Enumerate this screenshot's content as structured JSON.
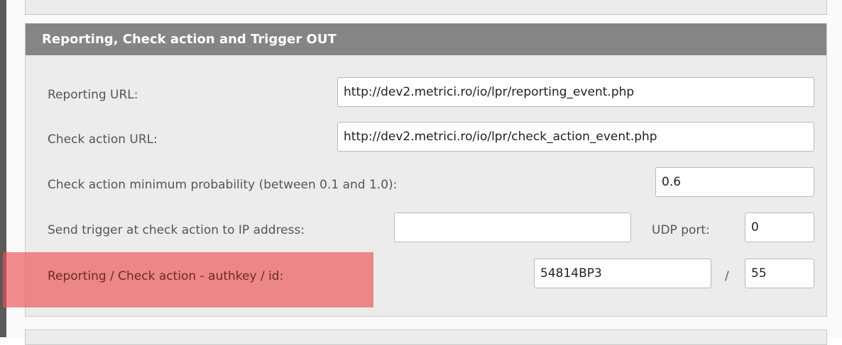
{
  "section": {
    "title": "Reporting, Check action and Trigger OUT"
  },
  "fields": {
    "reporting_url": {
      "label": "Reporting URL:",
      "value": "http://dev2.metrici.ro/io/lpr/reporting_event.php"
    },
    "check_action_url": {
      "label": "Check action URL:",
      "value": "http://dev2.metrici.ro/io/lpr/check_action_event.php"
    },
    "min_probability": {
      "label": "Check action minimum probability (between 0.1 and 1.0):",
      "value": "0.6"
    },
    "trigger_ip": {
      "label": "Send trigger at check action to IP address:",
      "value": ""
    },
    "udp_port": {
      "label": "UDP port:",
      "value": "0"
    },
    "authkey_id": {
      "label": "Reporting / Check action - authkey / id:",
      "authkey_value": "54814BP3",
      "separator": "/",
      "id_value": "55"
    }
  },
  "colors": {
    "header_bg": "#858585",
    "panel_bg": "#ececec",
    "highlight": "#ee5050"
  }
}
